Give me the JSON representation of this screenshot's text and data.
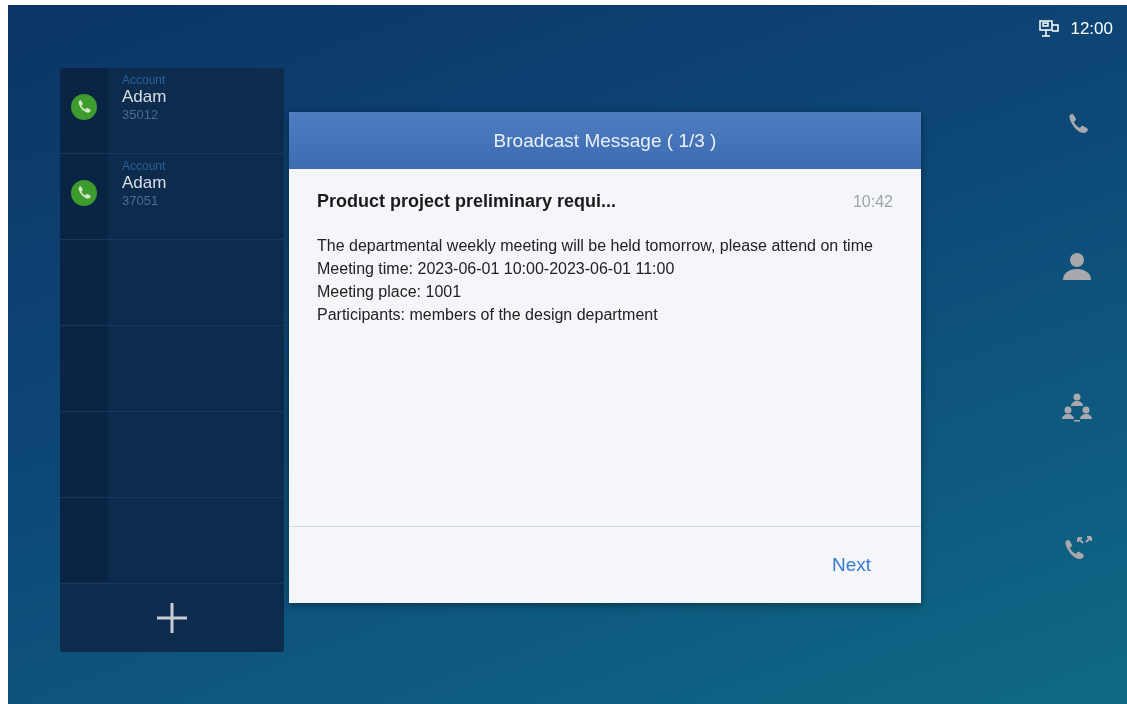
{
  "status_bar": {
    "time": "12:00"
  },
  "accounts": [
    {
      "label": "Account",
      "name": "Adam",
      "number": "35012"
    },
    {
      "label": "Account",
      "name": "Adam",
      "number": "37051"
    }
  ],
  "dock": [
    {
      "kind": "phone"
    },
    {
      "kind": "contact"
    },
    {
      "kind": "conference"
    },
    {
      "kind": "transfer"
    }
  ],
  "dialog": {
    "title": "Broadcast Message ( 1/3 )",
    "subject": "Product project preliminary requi...",
    "time": "10:42",
    "body": [
      "The departmental weekly meeting will be held tomorrow, please attend on time",
      "Meeting time: 2023-06-01 10:00-2023-06-01 11:00",
      "Meeting place: 1001",
      "Participants: members of the design department"
    ],
    "button": "Next"
  }
}
